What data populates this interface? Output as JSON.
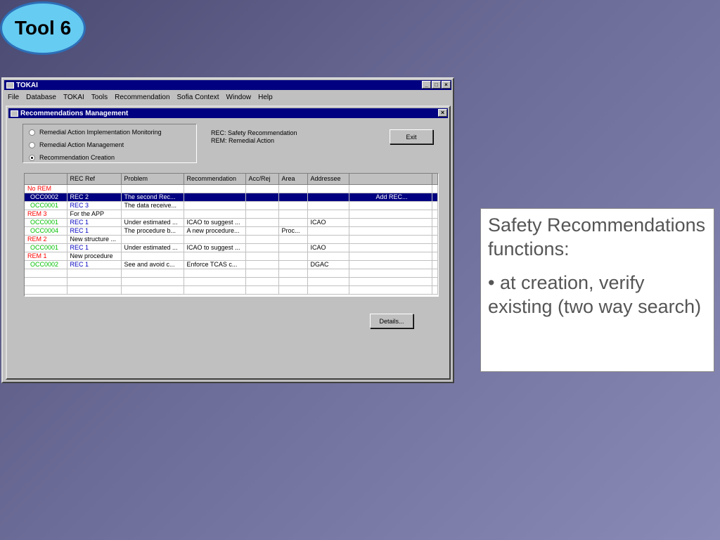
{
  "slide": {
    "badge": "Tool 6",
    "callout_title": "Safety Recommendations functions:",
    "callout_bullet": "• at creation, verify existing (two way search)"
  },
  "app": {
    "title": "TOKAI",
    "menu": [
      "File",
      "Database",
      "TOKAI",
      "Tools",
      "Recommendation",
      "Sofia Context",
      "Window",
      "Help"
    ],
    "child_title": "Recommendations Management",
    "radios": [
      {
        "label": "Remedial Action Implementation Monitoring",
        "checked": false
      },
      {
        "label": "Remedial Action Management",
        "checked": false
      },
      {
        "label": "Recommendation Creation",
        "checked": true
      }
    ],
    "legend_rec": "REC: Safety Recommendation",
    "legend_rem": "REM: Remedial Action",
    "exit_label": "Exit",
    "details_label": "Details...",
    "add_rec_label": "Add REC...",
    "columns": [
      "",
      "REC Ref",
      "Problem",
      "Recommendation",
      "Acc/Rej",
      "Area",
      "Addressee"
    ],
    "rows": [
      {
        "c0": "No REM",
        "t": "rem"
      },
      {
        "c0": "OCC0002",
        "c1": "REC 2",
        "c2": "The second Rec...",
        "t": "occ",
        "selected": true
      },
      {
        "c0": "OCC0001",
        "c1": "REC 3",
        "c2": "The data receive...",
        "t": "occ"
      },
      {
        "c0": "REM 3",
        "c1": "For the APP",
        "t": "rem"
      },
      {
        "c0": "OCC0001",
        "c1": "REC 1",
        "c2": "Under estimated ...",
        "c3": "ICAO to suggest ...",
        "c6": "ICAO",
        "t": "occ"
      },
      {
        "c0": "OCC0004",
        "c1": "REC 1",
        "c2": "The procedure b...",
        "c3": "A new procedure...",
        "c5": "Proc...",
        "t": "occ"
      },
      {
        "c0": "REM 2",
        "c1": "New structure ...",
        "t": "rem"
      },
      {
        "c0": "OCC0001",
        "c1": "REC 1",
        "c2": "Under estimated ...",
        "c3": "ICAO to suggest ...",
        "c6": "ICAO",
        "t": "occ"
      },
      {
        "c0": "REM 1",
        "c1": "New procedure",
        "t": "rem"
      },
      {
        "c0": "OCC0002",
        "c1": "REC 1",
        "c2": "See and avoid c...",
        "c3": "Enforce TCAS c...",
        "c6": "DGAC",
        "t": "occ"
      }
    ]
  }
}
